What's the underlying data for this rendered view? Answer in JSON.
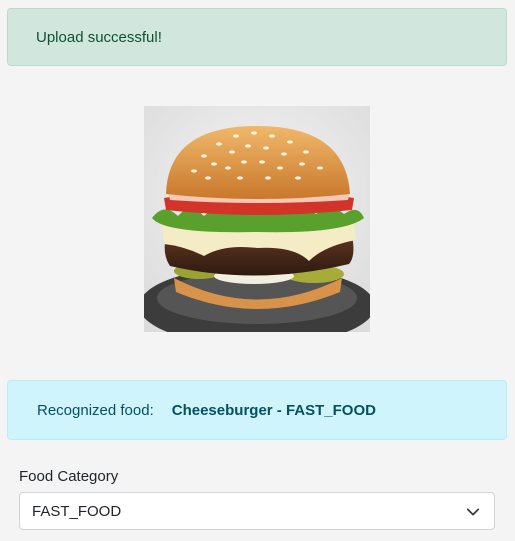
{
  "upload_alert": {
    "message": "Upload successful!"
  },
  "food_image": {
    "icon": "cheeseburger-photo"
  },
  "recognition": {
    "label": "Recognized food:",
    "result": "Cheeseburger - FAST_FOOD"
  },
  "category_field": {
    "label": "Food Category",
    "selected": "FAST_FOOD",
    "icon": "chevron-down-icon"
  },
  "colors": {
    "success_bg": "#d1e7dd",
    "success_text": "#0f5132",
    "info_bg": "#cff4fc",
    "info_text": "#055160",
    "page_bg": "#f4f4f4"
  }
}
